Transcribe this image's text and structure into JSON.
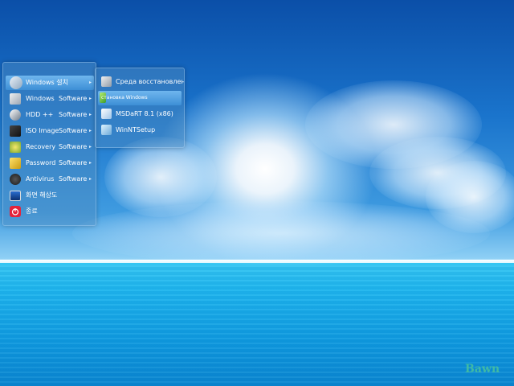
{
  "menu": {
    "items": [
      {
        "label": "Windows 설치",
        "category": "",
        "icon": "windows-install-icon",
        "has_submenu": true,
        "active": true
      },
      {
        "label": "Windows",
        "category": "Software",
        "icon": "windows-software-icon",
        "has_submenu": true
      },
      {
        "label": "HDD ++",
        "category": "Software",
        "icon": "hdd-icon",
        "has_submenu": true
      },
      {
        "label": "ISO Image",
        "category": "Software",
        "icon": "iso-image-icon",
        "has_submenu": true
      },
      {
        "label": "Recovery",
        "category": "Software",
        "icon": "recovery-icon",
        "has_submenu": true
      },
      {
        "label": "Password",
        "category": "Software",
        "icon": "password-key-icon",
        "has_submenu": true
      },
      {
        "label": "Antivirus",
        "category": "Software",
        "icon": "antivirus-icon",
        "has_submenu": true
      },
      {
        "label": "화면 해상도",
        "category": "",
        "icon": "display-resolution-icon",
        "has_submenu": false
      },
      {
        "label": "종료",
        "category": "",
        "icon": "power-icon",
        "has_submenu": false
      }
    ],
    "arrow": "▸"
  },
  "submenu": {
    "items": [
      {
        "label": "Среда восстановления 8",
        "icon": "recovery-env-icon",
        "active": false
      },
      {
        "label": "становка Windows",
        "icon": "windows-setup-icon",
        "active": true
      },
      {
        "label": "MSDaRT 8.1 (x86)",
        "icon": "msdart-icon",
        "active": false
      },
      {
        "label": "WinNTSetup",
        "icon": "winntsetup-icon",
        "active": false
      }
    ]
  },
  "watermark": "Bawn",
  "colors": {
    "highlight": "#4a9ee0",
    "menu_bg": "rgba(80,140,190,0.45)",
    "text": "#ffffff",
    "watermark": "#50c896"
  }
}
